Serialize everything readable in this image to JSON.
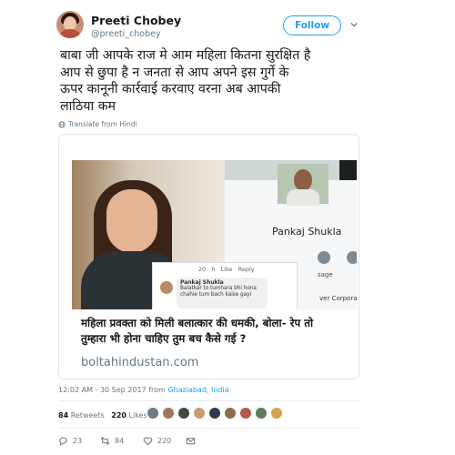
{
  "user": {
    "name": "Preeti Chobey",
    "handle": "@preeti_chobey"
  },
  "follow_label": "Follow",
  "tweet_text": "बाबा जी आपके राज मे आम महिला कितना सुरक्षित है\nआप से छुपा है न जनता से आप अपने इस गुर्गे के\nऊपर कानूनी कार्रवाई करवाए वरना अब आपकी\nलाठिया कम",
  "translate_label": "Translate from Hindi",
  "card": {
    "image_text": {
      "pankaj_name": "Pankaj Shukla",
      "comment_time": "20 h",
      "comment_like": "Like",
      "comment_reply": "Reply",
      "comment_author": "Pankaj Shukla",
      "comment_text": "Balatkar to tumhara bhi hona chahie tum bach kaise gayi",
      "side_label": "sage",
      "corp_label": "ver Corporati"
    },
    "title": "महिला प्रवक्ता को मिली बलात्कार की धमकी, बोला- रेप तो\nतुम्हारा भी होना चाहिए तुम बच कैसे गई ?",
    "domain": "boltahindustan.com"
  },
  "timestamp": {
    "time": "12:02 AM - 30 Sep 2017 from ",
    "location": "Ghaziabad, India"
  },
  "stats": {
    "retweets_count": "84",
    "retweets_label": "Retweets",
    "likes_count": "220",
    "likes_label": "Likes"
  },
  "actions": {
    "replies": "23",
    "retweets": "84",
    "likes": "220"
  },
  "colors": {
    "accent": "#1da1f2",
    "text": "#14171a",
    "muted": "#657786"
  },
  "likers_colors": [
    "#6c7a86",
    "#a0765a",
    "#3e4a3f",
    "#c99a70",
    "#2f3b4a",
    "#8a6d4e",
    "#b05a4a",
    "#5e7b5a",
    "#d3a34b"
  ]
}
